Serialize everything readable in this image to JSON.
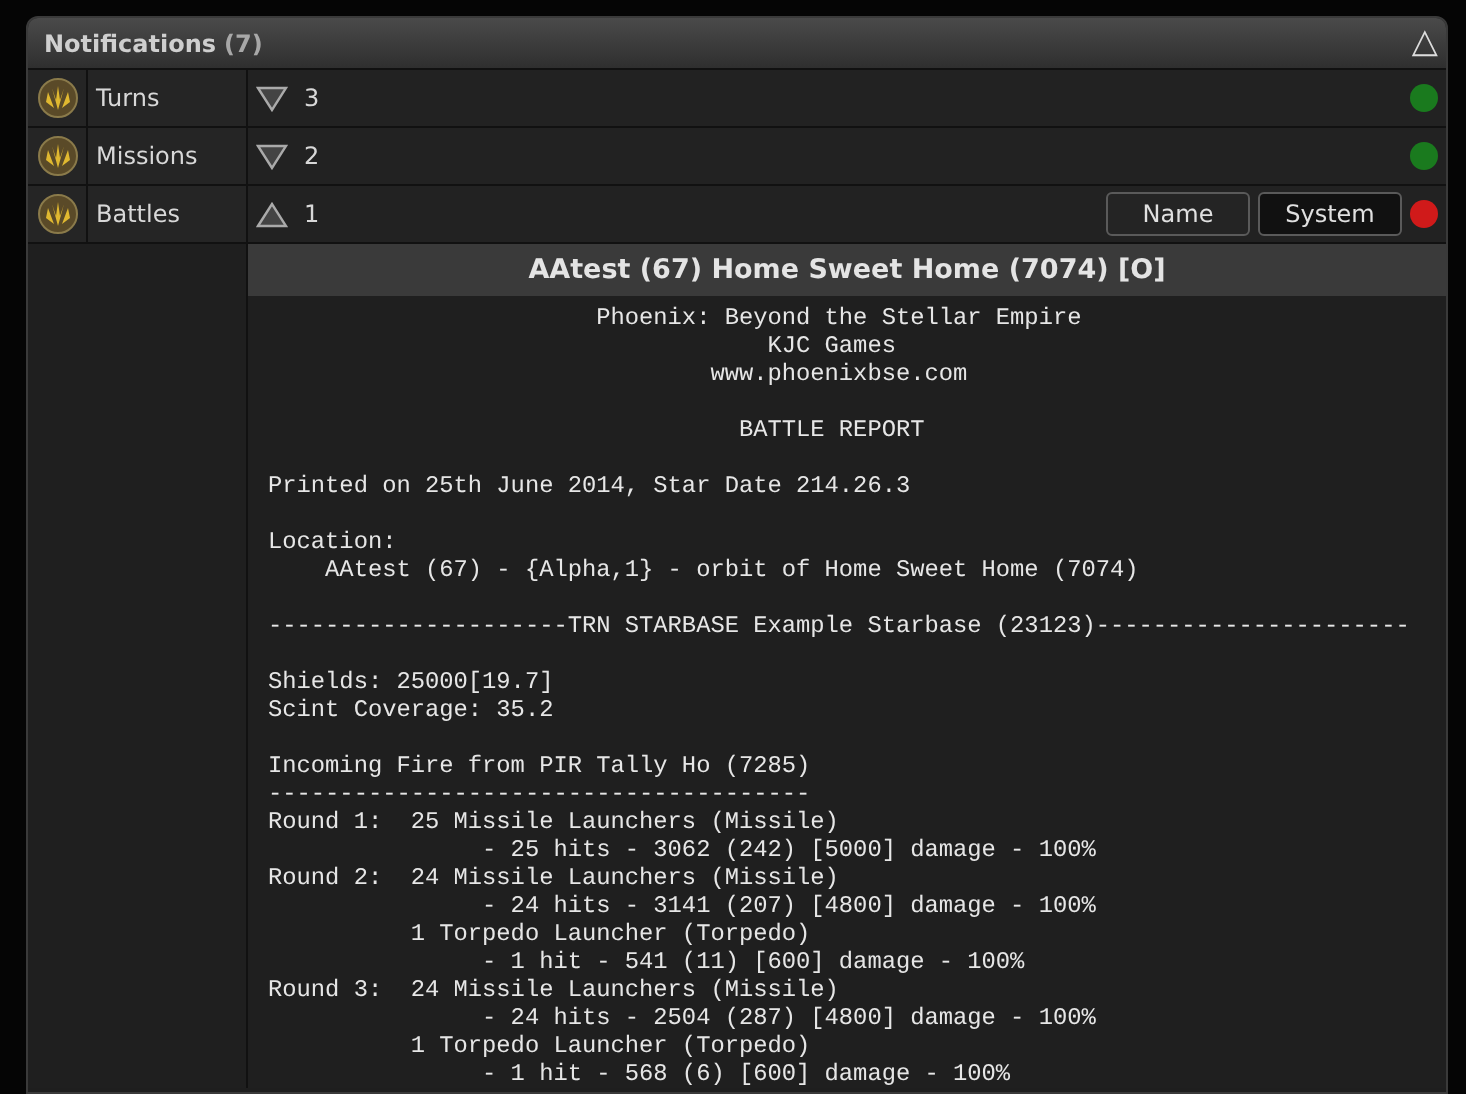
{
  "panel": {
    "title": "Notifications",
    "count": "(7)",
    "collapse_icon": "△"
  },
  "rows": [
    {
      "label": "Turns",
      "expanded": false,
      "count": "3",
      "color": "#1a7a1e",
      "buttons": []
    },
    {
      "label": "Missions",
      "expanded": false,
      "count": "2",
      "color": "#1a7a1e",
      "buttons": []
    },
    {
      "label": "Battles",
      "expanded": true,
      "count": "1",
      "color": "#d01a1a",
      "buttons": [
        {
          "label": "Name",
          "selected": false
        },
        {
          "label": "System",
          "selected": true
        }
      ],
      "report": {
        "title": "AAtest (67) Home Sweet Home (7074) [O]",
        "blocks": [
          [
            "                       Phoenix: Beyond the Stellar Empire",
            "                                   KJC Games",
            "                               www.phoenixbse.com"
          ],
          [
            "                                 BATTLE REPORT"
          ],
          [
            "Printed on 25th June 2014, Star Date 214.26.3"
          ],
          [
            "Location:",
            "    AAtest (67) - {Alpha,1} - orbit of Home Sweet Home (7074)"
          ],
          [
            "---------------------TRN STARBASE Example Starbase (23123)----------------------"
          ],
          [
            "Shields: 25000[19.7]",
            "Scint Coverage: 35.2"
          ],
          [
            "Incoming Fire from PIR Tally Ho (7285)",
            "--------------------------------------",
            "Round 1:  25 Missile Launchers (Missile)",
            "               - 25 hits - 3062 (242) [5000] damage - 100%",
            "Round 2:  24 Missile Launchers (Missile)",
            "               - 24 hits - 3141 (207) [4800] damage - 100%",
            "          1 Torpedo Launcher (Torpedo)",
            "               - 1 hit - 541 (11) [600] damage - 100%",
            "Round 3:  24 Missile Launchers (Missile)",
            "               - 24 hits - 2504 (287) [4800] damage - 100%",
            "          1 Torpedo Launcher (Torpedo)",
            "               - 1 hit - 568 (6) [600] damage - 100%"
          ]
        ]
      }
    }
  ]
}
